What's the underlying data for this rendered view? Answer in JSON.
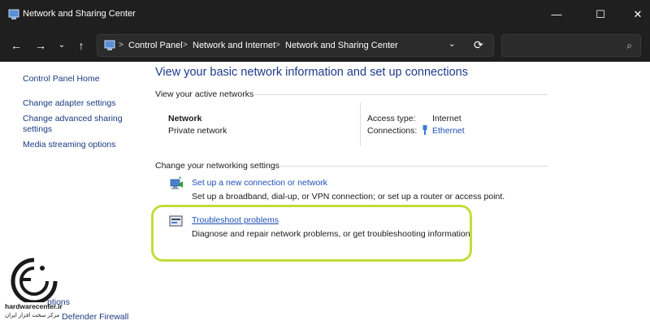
{
  "window": {
    "title": "Network and Sharing Center",
    "controls": {
      "minimize": "—",
      "maximize": "☐",
      "close": "✕"
    }
  },
  "nav": {
    "back": "←",
    "forward": "→",
    "recent": "⌄",
    "up": "↑",
    "breadcrumb": [
      "Control Panel",
      "Network and Internet",
      "Network and Sharing Center"
    ],
    "separator": ">",
    "dropdown": "⌄",
    "refresh": "⟳",
    "search_placeholder": "",
    "search_icon": "⌕"
  },
  "sidebar": {
    "items": [
      {
        "label": "Control Panel Home"
      },
      {
        "label": "Change adapter settings"
      },
      {
        "label": "Change advanced sharing"
      },
      {
        "label": "settings"
      },
      {
        "label": "Media streaming options"
      }
    ],
    "partial_items": [
      {
        "label": "ptions"
      },
      {
        "label": "Defender Firewall"
      }
    ]
  },
  "main": {
    "title": "View your basic network information and set up connections",
    "active_networks_label": "View your active networks",
    "network": {
      "name": "Network",
      "category": "Private network",
      "access_type_label": "Access type:",
      "access_type_value": "Internet",
      "connections_label": "Connections:",
      "connections_value": "Ethernet"
    },
    "change_settings_label": "Change your networking settings",
    "tasks": [
      {
        "link": "Set up a new connection or network",
        "description": "Set up a broadband, dial-up, or VPN connection; or set up a router or access point."
      },
      {
        "link": "Troubleshoot problems",
        "description": "Diagnose and repair network problems, or get troubleshooting information."
      }
    ]
  },
  "watermark": {
    "name": "hardwarecenter.ir",
    "subtitle": "مرکز سخت افزار ایران"
  },
  "colors": {
    "titlebar": "#1f1f1f",
    "link": "#1e4fb8",
    "heading": "#1e3a8a",
    "highlight": "#c4dc3a"
  }
}
